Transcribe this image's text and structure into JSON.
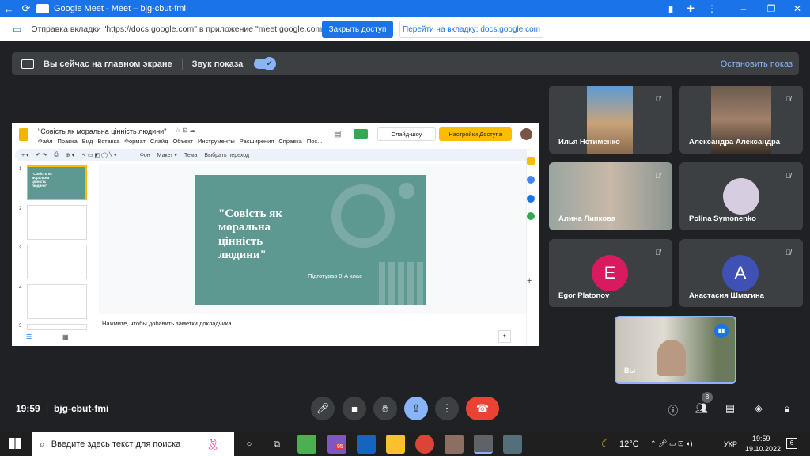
{
  "titlebar": {
    "title": "Google Meet - Meet – bjg-cbut-fmi"
  },
  "infobar": {
    "text": "Отправка вкладки \"https://docs.google.com\" в приложение \"meet.google.com\"...",
    "share_btn": "Закрыть доступ",
    "goto_btn": "Перейти на вкладку: docs.google.com"
  },
  "present": {
    "label": "Вы сейчас на главном экране",
    "sound": "Звук показа",
    "stop": "Остановить показ"
  },
  "slides": {
    "doc_title": "\"Совість як моральна цінність людини\"",
    "menu": [
      "Файл",
      "Правка",
      "Вид",
      "Вставка",
      "Формат",
      "Слайд",
      "Объект",
      "Инструменты",
      "Расширения",
      "Справка",
      "Пос..."
    ],
    "slideshow": "Слайд-шоу",
    "access": "Настройки Доступа",
    "toolbar_text": [
      "Фон",
      "Макет ▾",
      "Тема",
      "Выбрать переход"
    ],
    "slide_title": "\"Совість як моральна цінність людини\"",
    "slide_sub": "Підготував 9-А клас",
    "notes": "Нажмите, чтобы добавить заметки докладчика",
    "thumb_nums": [
      "1",
      "2",
      "3",
      "4",
      "5"
    ],
    "thumb1_title": "\"Совість як моральна цінність людини\""
  },
  "participants": [
    {
      "name": "Илья Нетименко",
      "avatar": ""
    },
    {
      "name": "Александра Александра",
      "avatar": ""
    },
    {
      "name": "Алина Липкова",
      "avatar": ""
    },
    {
      "name": "Polina Symonenko",
      "avatar": ""
    },
    {
      "name": "Egor Platonov",
      "avatar": "E",
      "color": "#d81b60"
    },
    {
      "name": "Анастасия Шмагина",
      "avatar": "A",
      "color": "#3f51b5"
    }
  ],
  "self": {
    "label": "Вы"
  },
  "meeting": {
    "time": "19:59",
    "code": "bjg-cbut-fmi",
    "people_count": "8"
  },
  "taskbar": {
    "search": "Введите здесь текст для поиска",
    "badge": "95",
    "temp": "12°C",
    "lang": "УКР",
    "time": "19:59",
    "date": "19.10.2022",
    "notif": "6"
  }
}
